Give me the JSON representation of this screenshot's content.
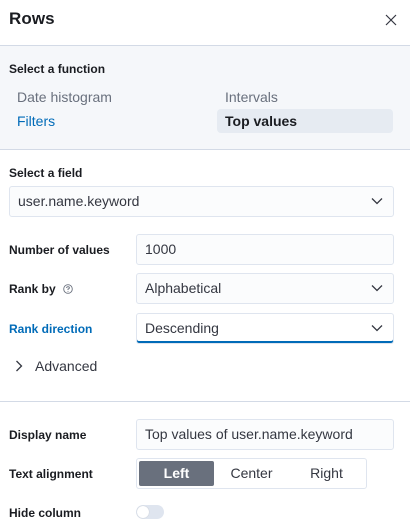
{
  "header": {
    "title": "Rows"
  },
  "function_section": {
    "label": "Select a function",
    "options": [
      {
        "label": "Date histogram",
        "state": "muted"
      },
      {
        "label": "Intervals",
        "state": "muted"
      },
      {
        "label": "Filters",
        "state": "link"
      },
      {
        "label": "Top values",
        "state": "selected"
      }
    ]
  },
  "field": {
    "label": "Select a field",
    "value": "user.name.keyword"
  },
  "number_of_values": {
    "label": "Number of values",
    "value": "1000"
  },
  "rank_by": {
    "label": "Rank by",
    "value": "Alphabetical"
  },
  "rank_direction": {
    "label": "Rank direction",
    "value": "Descending"
  },
  "advanced": {
    "label": "Advanced"
  },
  "display_name": {
    "label": "Display name",
    "value": "Top values of user.name.keyword"
  },
  "text_alignment": {
    "label": "Text alignment",
    "options": [
      "Left",
      "Center",
      "Right"
    ],
    "selected": "Left"
  },
  "hide_column": {
    "label": "Hide column",
    "enabled": false
  },
  "colors": {
    "link": "#006bb8",
    "selected_bg": "#e6ebf2",
    "active_segment": "#69707d",
    "border": "#d3dae6"
  }
}
